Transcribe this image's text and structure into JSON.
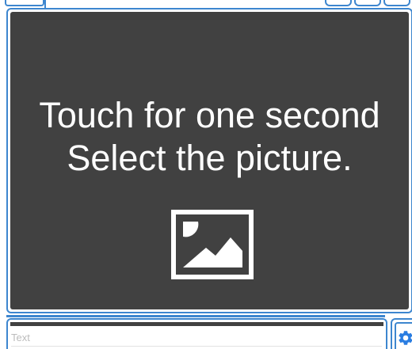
{
  "picker": {
    "line1": "Touch for one second",
    "line2": "Select the picture.",
    "icon": "picture-icon"
  },
  "text_field": {
    "placeholder": "Text",
    "value": ""
  },
  "settings": {
    "icon": "gear-icon"
  },
  "colors": {
    "accent": "#3d86cf",
    "panel": "#414141",
    "panel_text": "#ffffff",
    "placeholder": "#bcbcbc"
  }
}
